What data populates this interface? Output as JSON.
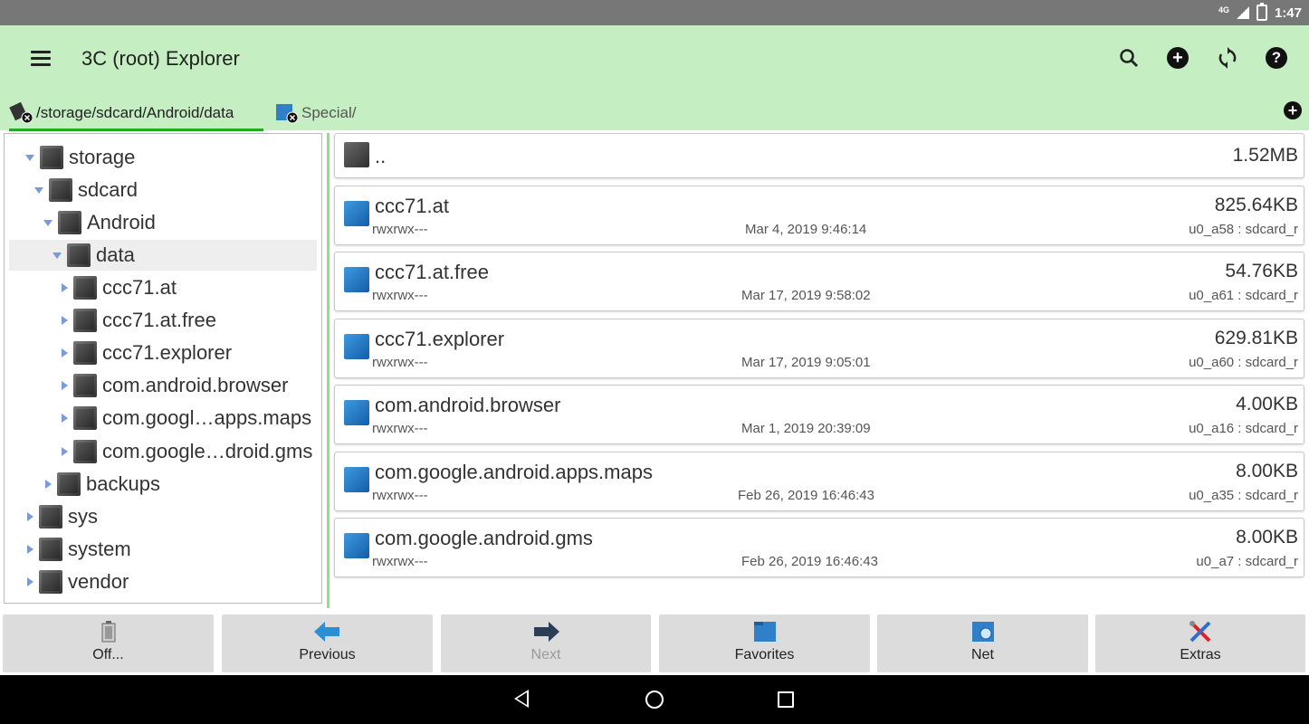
{
  "status_bar": {
    "network": "4G",
    "time": "1:47"
  },
  "app_bar": {
    "title": "3C (root) Explorer"
  },
  "tabs": [
    {
      "label": "/storage/sdcard/Android/data"
    },
    {
      "label": "Special/"
    }
  ],
  "tree": [
    {
      "label": "storage",
      "expanded": true
    },
    {
      "label": "sdcard",
      "expanded": true
    },
    {
      "label": "Android",
      "expanded": true
    },
    {
      "label": "data",
      "expanded": true,
      "selected": true
    },
    {
      "label": "ccc71.at",
      "expanded": false
    },
    {
      "label": "ccc71.at.free",
      "expanded": false
    },
    {
      "label": "ccc71.explorer",
      "expanded": false
    },
    {
      "label": "com.android.browser",
      "expanded": false
    },
    {
      "label": "com.googl…apps.maps",
      "expanded": false
    },
    {
      "label": "com.google…droid.gms",
      "expanded": false
    },
    {
      "label": "backups",
      "expanded": false
    },
    {
      "label": "sys",
      "expanded": false
    },
    {
      "label": "system",
      "expanded": false
    },
    {
      "label": "vendor",
      "expanded": false
    }
  ],
  "files": [
    {
      "name": "..",
      "size": "1.52MB"
    },
    {
      "name": "ccc71.at",
      "size": "825.64KB",
      "perms": "rwxrwx---",
      "date": "Mar 4, 2019 9:46:14",
      "owner": "u0_a58 : sdcard_r"
    },
    {
      "name": "ccc71.at.free",
      "size": "54.76KB",
      "perms": "rwxrwx---",
      "date": "Mar 17, 2019 9:58:02",
      "owner": "u0_a61 : sdcard_r"
    },
    {
      "name": "ccc71.explorer",
      "size": "629.81KB",
      "perms": "rwxrwx---",
      "date": "Mar 17, 2019 9:05:01",
      "owner": "u0_a60 : sdcard_r"
    },
    {
      "name": "com.android.browser",
      "size": "4.00KB",
      "perms": "rwxrwx---",
      "date": "Mar 1, 2019 20:39:09",
      "owner": "u0_a16 : sdcard_r"
    },
    {
      "name": "com.google.android.apps.maps",
      "size": "8.00KB",
      "perms": "rwxrwx---",
      "date": "Feb 26, 2019 16:46:43",
      "owner": "u0_a35 : sdcard_r"
    },
    {
      "name": "com.google.android.gms",
      "size": "8.00KB",
      "perms": "rwxrwx---",
      "date": "Feb 26, 2019 16:46:43",
      "owner": "u0_a7 : sdcard_r"
    }
  ],
  "bottom_bar": {
    "off": "Off...",
    "previous": "Previous",
    "next": "Next",
    "favorites": "Favorites",
    "net": "Net",
    "extras": "Extras"
  },
  "icons": {
    "menu": "menu-icon",
    "search": "search-icon",
    "add": "add-circle-icon",
    "refresh": "refresh-icon",
    "help": "help-icon"
  },
  "colors": {
    "app_bar_bg": "#c5efc2",
    "tab_indicator": "#22aa22",
    "splitter": "#8fe080",
    "folder_blue": "#2f80c8"
  }
}
